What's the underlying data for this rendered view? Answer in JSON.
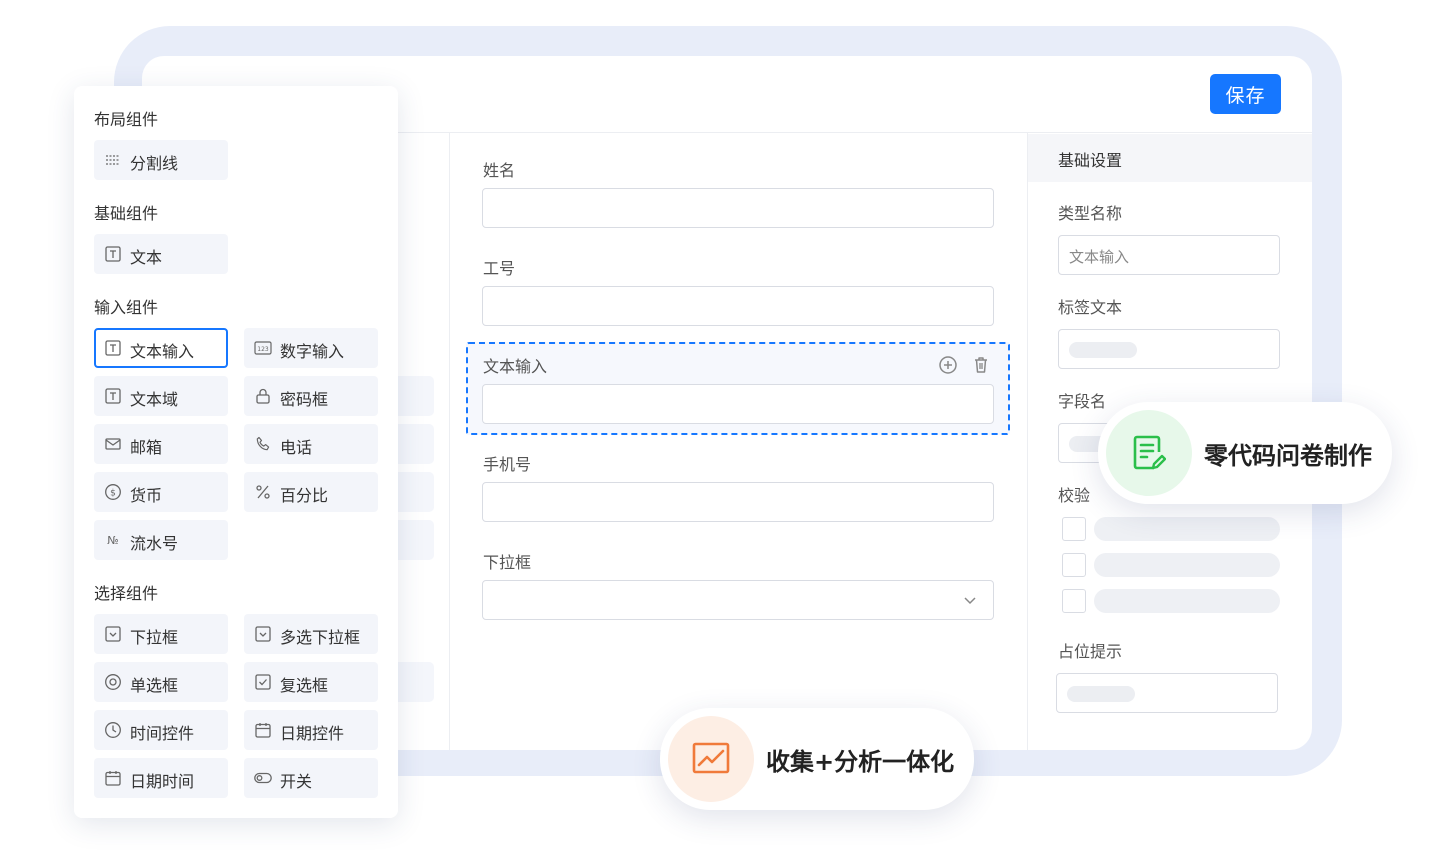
{
  "header": {
    "save_label": "保存"
  },
  "form": {
    "fields": [
      {
        "label": "姓名"
      },
      {
        "label": "工号"
      },
      {
        "label": "文本输入"
      },
      {
        "label": "手机号"
      },
      {
        "label": "下拉框"
      }
    ]
  },
  "settings": {
    "title": "基础设置",
    "type_name_label": "类型名称",
    "type_name_value": "文本输入",
    "tag_text_label": "标签文本",
    "field_name_label": "字段名",
    "validation_label": "校验",
    "placeholder_label": "占位提示"
  },
  "palette": {
    "groups": [
      {
        "title": "布局组件",
        "items": [
          {
            "label": "分割线",
            "icon": "divider-icon"
          }
        ]
      },
      {
        "title": "基础组件",
        "items": [
          {
            "label": "文本",
            "icon": "text-icon"
          }
        ]
      },
      {
        "title": "输入组件",
        "items": [
          {
            "label": "文本输入",
            "icon": "text-icon",
            "active": true
          },
          {
            "label": "数字输入",
            "icon": "number-icon"
          },
          {
            "label": "文本域",
            "icon": "text-icon"
          },
          {
            "label": "密码框",
            "icon": "lock-icon"
          },
          {
            "label": "邮箱",
            "icon": "mail-icon"
          },
          {
            "label": "电话",
            "icon": "phone-icon"
          },
          {
            "label": "货币",
            "icon": "currency-icon"
          },
          {
            "label": "百分比",
            "icon": "percent-icon"
          },
          {
            "label": "流水号",
            "icon": "serial-number-icon"
          }
        ]
      },
      {
        "title": "选择组件",
        "items": [
          {
            "label": "下拉框",
            "icon": "dropdown-icon"
          },
          {
            "label": "多选下拉框",
            "icon": "dropdown-icon"
          },
          {
            "label": "单选框",
            "icon": "radio-icon"
          },
          {
            "label": "复选框",
            "icon": "checkbox-icon"
          },
          {
            "label": "时间控件",
            "icon": "clock-icon"
          },
          {
            "label": "日期控件",
            "icon": "calendar-icon"
          },
          {
            "label": "日期时间",
            "icon": "calendar-icon"
          },
          {
            "label": "开关",
            "icon": "toggle-icon"
          }
        ]
      }
    ]
  },
  "badges": {
    "survey": "零代码问卷制作",
    "analytics": "收集+分析一体化"
  },
  "colors": {
    "accent": "#1677ff",
    "frame": "#e8edf9",
    "survey_badge_bg": "#e7f8ea",
    "survey_icon": "#2bbf4a",
    "analytics_badge_bg": "#fdeee4",
    "analytics_icon": "#f07a3a"
  }
}
